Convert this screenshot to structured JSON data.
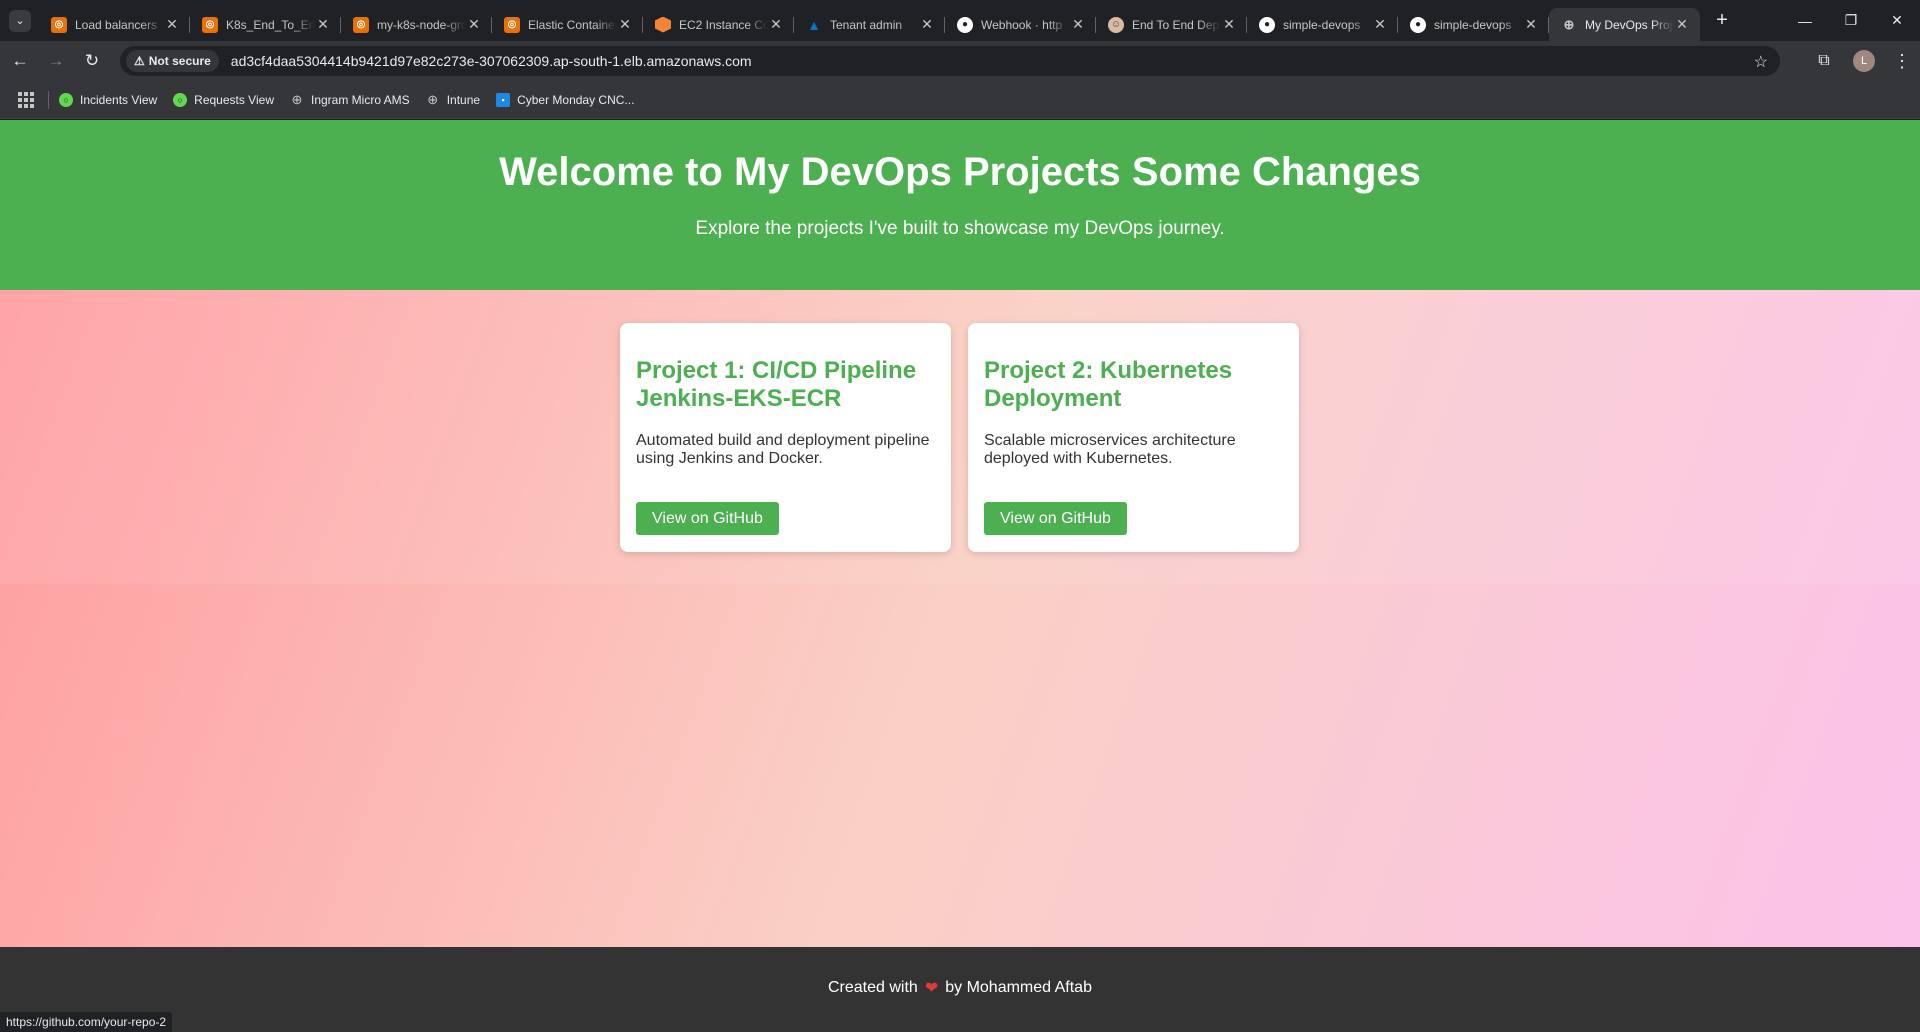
{
  "browser": {
    "tabs": [
      {
        "title": "Load balancers",
        "icon": "aws-icon",
        "color": "#e8710a"
      },
      {
        "title": "K8s_End_To_End",
        "icon": "aws-icon",
        "color": "#e8710a"
      },
      {
        "title": "my-k8s-node-group",
        "icon": "aws-icon",
        "color": "#e8710a"
      },
      {
        "title": "Elastic Container",
        "icon": "aws-icon",
        "color": "#e8710a"
      },
      {
        "title": "EC2 Instance Connect",
        "icon": "ec2-icon",
        "color": "#f58536"
      },
      {
        "title": "Tenant admin",
        "icon": "azure-icon",
        "color": "#0078d4"
      },
      {
        "title": "Webhook · http",
        "icon": "github-icon",
        "color": "#ffffff"
      },
      {
        "title": "End To End Deployment",
        "icon": "jenkins-icon",
        "color": "#d8bba3"
      },
      {
        "title": "simple-devops",
        "icon": "github-icon",
        "color": "#ffffff"
      },
      {
        "title": "simple-devops",
        "icon": "github-icon",
        "color": "#ffffff"
      },
      {
        "title": "My DevOps Projects",
        "icon": "globe-icon",
        "color": "#c4c7c5",
        "active": true
      }
    ],
    "security_label": "Not secure",
    "url": "ad3cf4daa5304414b9421d97e82c273e-307062309.ap-south-1.elb.amazonaws.com",
    "profile_initial": "L",
    "bookmarks": [
      {
        "label": "Incidents View",
        "icon": "servicenow-icon",
        "color": "#62d84e"
      },
      {
        "label": "Requests View",
        "icon": "servicenow-icon",
        "color": "#62d84e"
      },
      {
        "label": "Ingram Micro AMS",
        "icon": "globe-icon",
        "color": "#c4c7c5"
      },
      {
        "label": "Intune",
        "icon": "globe-icon",
        "color": "#c4c7c5"
      },
      {
        "label": "Cyber Monday CNC...",
        "icon": "store-icon",
        "color": "#1e88e5"
      }
    ],
    "status_url": "https://github.com/your-repo-2"
  },
  "page": {
    "hero": {
      "title": "Welcome to My DevOps Projects Some Changes",
      "subtitle": "Explore the projects I've built to showcase my DevOps journey."
    },
    "projects": [
      {
        "title": "Project 1: CI/CD Pipeline Jenkins-EKS-ECR",
        "description": "Automated build and deployment pipeline using Jenkins and Docker.",
        "button": "View on GitHub"
      },
      {
        "title": "Project 2: Kubernetes Deployment",
        "description": "Scalable microservices architecture deployed with Kubernetes.",
        "button": "View on GitHub"
      }
    ],
    "footer": {
      "prefix": "Created with",
      "heart": "❤",
      "suffix": "by Mohammed Aftab"
    },
    "colors": {
      "accent": "#4caf50",
      "footer_bg": "#333333"
    }
  }
}
